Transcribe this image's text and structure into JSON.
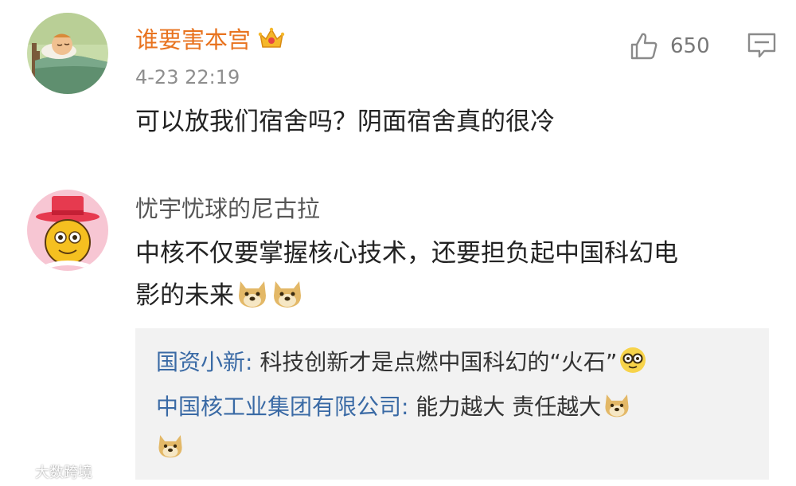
{
  "comments": [
    {
      "username": "谁要害本宫",
      "timestamp": "4-23 22:19",
      "text": "可以放我们宿舍吗？阴面宿舍真的很冷",
      "likes": "650",
      "username_color": "#e8731f",
      "badge_icon": "crown-badge-icon"
    },
    {
      "username": "忧宇忧球的尼古拉",
      "text_line1": "中核不仅要掌握核心技术，还要担负起中国科幻电",
      "text_line2": "影的未来"
    }
  ],
  "replies": [
    {
      "author": "国资小新:",
      "text": " 科技创新才是点燃中国科幻的“火石”"
    },
    {
      "author": "中国核工业集团有限公司:",
      "text": " 能力越大 责任越大"
    }
  ],
  "watermark": {
    "text": "大数跨境"
  },
  "colors": {
    "link_blue": "#3a6aa5",
    "orange": "#e8731f"
  }
}
